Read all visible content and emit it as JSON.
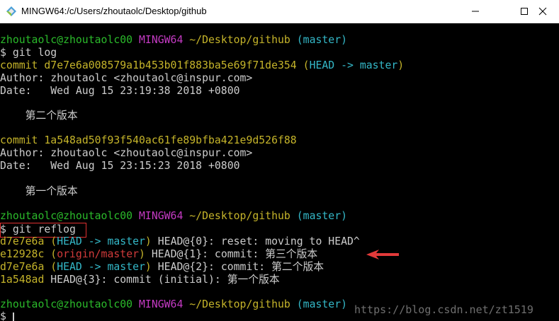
{
  "window": {
    "title": "MINGW64:/c/Users/zhoutaolc/Desktop/github",
    "icons": [
      "mingw-icon",
      "minimize-icon",
      "maximize-icon",
      "close-icon"
    ]
  },
  "terminal": {
    "prompt1": {
      "user": "zhoutaolc@zhoutaolc00",
      "system": "MINGW64",
      "path": "~/Desktop/github",
      "branch": "(master)"
    },
    "cmd1": "$ git log",
    "commit1": {
      "label": "commit",
      "hash": "d7e7e6a008579a1b453b01f883ba5e69f71de354",
      "ref_open": "(",
      "ref_head": "HEAD -> master",
      "ref_close": ")"
    },
    "author1": "Author: zhoutaolc <zhoutaolc@inspur.com>",
    "date1": "Date:   Wed Aug 15 23:19:38 2018 +0800",
    "msg1": "    第二个版本",
    "commit2": {
      "label": "commit",
      "hash": "1a548ad50f93f540ac61fe89bfba421e9d526f88"
    },
    "author2": "Author: zhoutaolc <zhoutaolc@inspur.com>",
    "date2": "Date:   Wed Aug 15 23:15:23 2018 +0800",
    "msg2": "    第一个版本",
    "prompt2": {
      "user": "zhoutaolc@zhoutaolc00",
      "system": "MINGW64",
      "path": "~/Desktop/github",
      "branch": "(master)"
    },
    "cmd2_prompt": "$ ",
    "cmd2": "git reflog",
    "reflog": [
      {
        "hash": "d7e7e6a",
        "ref_open": "(",
        "ref": "HEAD -> master",
        "ref_close": ")",
        "rest": " HEAD@{0}: reset: moving to HEAD^"
      },
      {
        "hash": "e12928c",
        "ref_open": "(",
        "ref": "origin/master",
        "ref_close": ")",
        "rest": " HEAD@{1}: commit: 第三个版本"
      },
      {
        "hash": "d7e7e6a",
        "ref_open": "(",
        "ref": "HEAD -> master",
        "ref_close": ")",
        "rest": " HEAD@{2}: commit: 第二个版本"
      },
      {
        "hash": "1a548ad",
        "rest": " HEAD@{3}: commit (initial): 第一个版本"
      }
    ],
    "prompt3": {
      "user": "zhoutaolc@zhoutaolc00",
      "system": "MINGW64",
      "path": "~/Desktop/github",
      "branch": "(master)"
    },
    "cmd3": "$ "
  },
  "watermark": "https://blog.csdn.net/zt1519",
  "colors": {
    "green": "#2bbb2b",
    "magenta": "#c43ac3",
    "yellow": "#c5b42a",
    "cyan": "#34b8c8",
    "red": "#d23b3b"
  }
}
